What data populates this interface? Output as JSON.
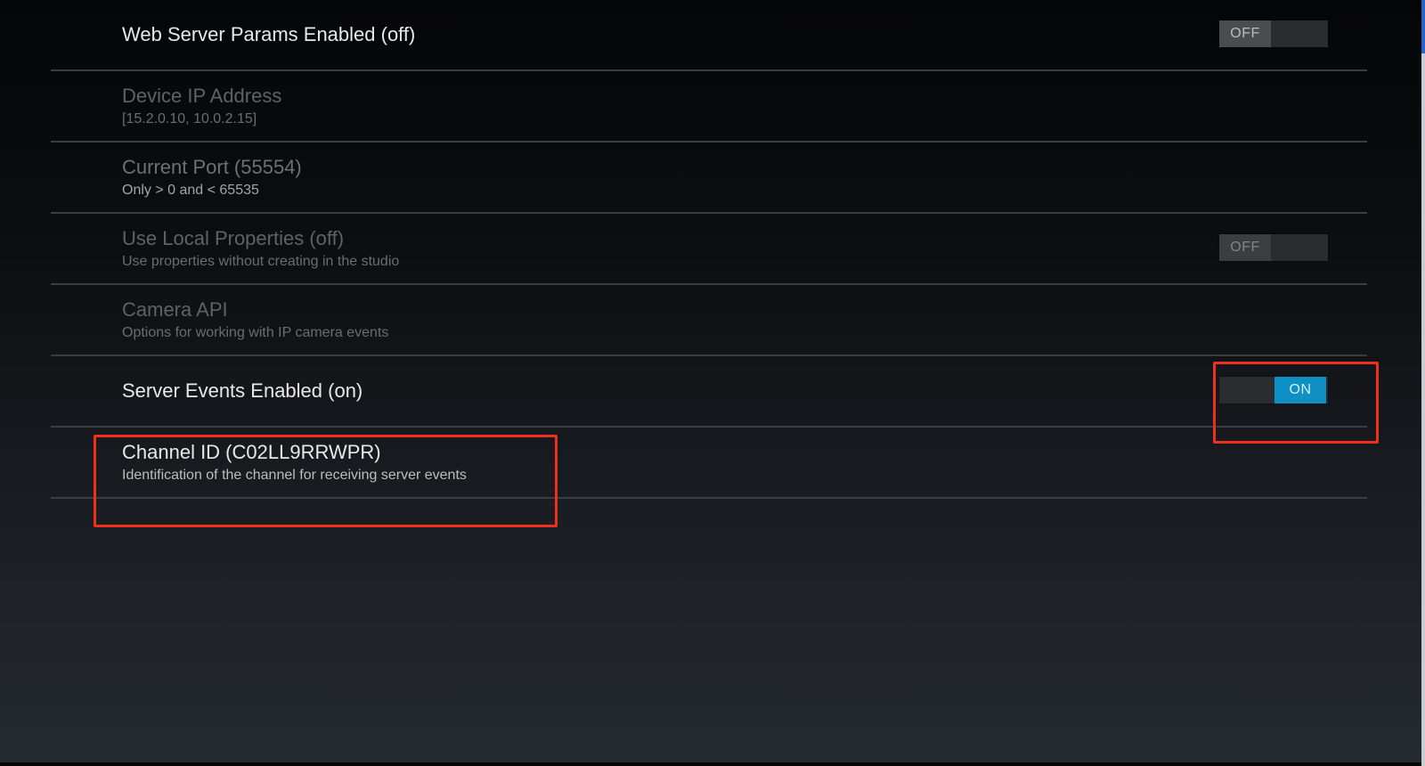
{
  "settings": [
    {
      "title": "Web Server Params Enabled (off)",
      "subtitle": null,
      "toggle": {
        "state": "off",
        "label": "OFF"
      },
      "enabled": true
    },
    {
      "title": "Device IP Address",
      "subtitle": "[15.2.0.10, 10.0.2.15]",
      "enabled": false
    },
    {
      "title": "Current Port (55554)",
      "subtitle": "Only > 0 and < 65535",
      "enabled": false
    },
    {
      "title": "Use Local Properties (off)",
      "subtitle": "Use properties without creating in the studio",
      "toggle": {
        "state": "off",
        "label": "OFF"
      },
      "enabled": false
    },
    {
      "title": "Camera API",
      "subtitle": "Options for working with IP camera events",
      "enabled": false
    },
    {
      "title": "Server Events Enabled (on)",
      "subtitle": null,
      "toggle": {
        "state": "on",
        "label": "ON"
      },
      "enabled": true
    },
    {
      "title": "Channel ID (C02LL9RRWPR)",
      "subtitle": "Identification of the channel for receiving server events",
      "enabled": true
    }
  ],
  "annotations": {
    "highlight_color": "#f0301a",
    "highlighted": [
      "server-events-toggle",
      "channel-id-setting"
    ]
  },
  "colors": {
    "toggle_on": "#0e90c4",
    "toggle_off_thumb": "#4a4c4f"
  }
}
